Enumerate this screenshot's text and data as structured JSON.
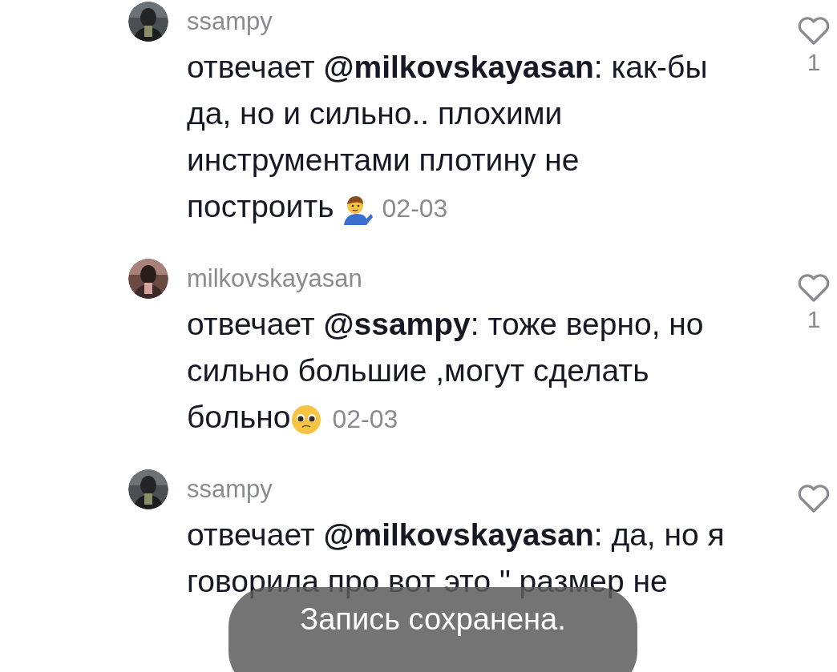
{
  "comments": [
    {
      "username": "ssampy",
      "text": "отвечает **@milkovskayasan**: как-бы да, но и сильно.. плохими инструментами плотину не построить",
      "emoji": {
        "kind": "person"
      },
      "date": "02-03",
      "likes": "1"
    },
    {
      "username": "milkovskayasan",
      "text": "отвечает **@ssampy**: тоже верно, но сильно большие ,могут сделать больно",
      "emoji": {
        "kind": "pleading"
      },
      "date": "02-03",
      "likes": "1"
    },
    {
      "username": "ssampy",
      "text": "отвечает **@milkovskayasan**: да, но я говорила про вот это \" размер не"
    }
  ],
  "toast": {
    "text": "Запись сохранена."
  }
}
